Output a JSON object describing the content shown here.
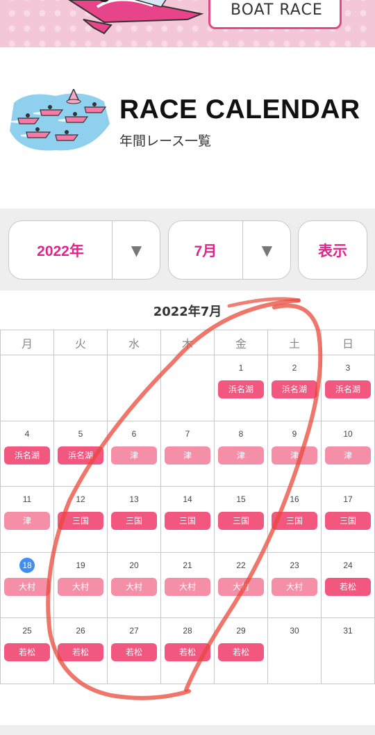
{
  "banner": {
    "brand_text": "BOAT RACE"
  },
  "hero": {
    "title": "RACE CALENDAR",
    "subtitle": "年間レース一覧"
  },
  "controls": {
    "year_value": "2022年",
    "month_value": "7月",
    "dropdown_arrow": "▼",
    "show_label": "表示"
  },
  "calendar": {
    "title": "2022年7月",
    "weekdays": [
      "月",
      "火",
      "水",
      "木",
      "金",
      "土",
      "日"
    ],
    "today": 18,
    "weeks": [
      [
        {
          "day": ""
        },
        {
          "day": ""
        },
        {
          "day": ""
        },
        {
          "day": ""
        },
        {
          "day": "1",
          "venue": "浜名湖",
          "shade": "dark"
        },
        {
          "day": "2",
          "venue": "浜名湖",
          "shade": "dark"
        },
        {
          "day": "3",
          "venue": "浜名湖",
          "shade": "dark"
        }
      ],
      [
        {
          "day": "4",
          "venue": "浜名湖",
          "shade": "dark"
        },
        {
          "day": "5",
          "venue": "浜名湖",
          "shade": "dark"
        },
        {
          "day": "6",
          "venue": "津",
          "shade": "light"
        },
        {
          "day": "7",
          "venue": "津",
          "shade": "light"
        },
        {
          "day": "8",
          "venue": "津",
          "shade": "light"
        },
        {
          "day": "9",
          "venue": "津",
          "shade": "light"
        },
        {
          "day": "10",
          "venue": "津",
          "shade": "light"
        }
      ],
      [
        {
          "day": "11",
          "venue": "津",
          "shade": "light"
        },
        {
          "day": "12",
          "venue": "三国",
          "shade": "dark"
        },
        {
          "day": "13",
          "venue": "三国",
          "shade": "dark"
        },
        {
          "day": "14",
          "venue": "三国",
          "shade": "dark"
        },
        {
          "day": "15",
          "venue": "三国",
          "shade": "dark"
        },
        {
          "day": "16",
          "venue": "三国",
          "shade": "dark"
        },
        {
          "day": "17",
          "venue": "三国",
          "shade": "dark"
        }
      ],
      [
        {
          "day": "18",
          "venue": "大村",
          "shade": "light"
        },
        {
          "day": "19",
          "venue": "大村",
          "shade": "light"
        },
        {
          "day": "20",
          "venue": "大村",
          "shade": "light"
        },
        {
          "day": "21",
          "venue": "大村",
          "shade": "light"
        },
        {
          "day": "22",
          "venue": "大村",
          "shade": "light"
        },
        {
          "day": "23",
          "venue": "大村",
          "shade": "light"
        },
        {
          "day": "24",
          "venue": "若松",
          "shade": "dark"
        }
      ],
      [
        {
          "day": "25",
          "venue": "若松",
          "shade": "dark"
        },
        {
          "day": "26",
          "venue": "若松",
          "shade": "dark"
        },
        {
          "day": "27",
          "venue": "若松",
          "shade": "dark"
        },
        {
          "day": "28",
          "venue": "若松",
          "shade": "dark"
        },
        {
          "day": "29",
          "venue": "若松",
          "shade": "dark"
        },
        {
          "day": "30"
        },
        {
          "day": "31"
        }
      ]
    ]
  },
  "colors": {
    "accent": "#e0248a",
    "tag_dark": "#f2577f",
    "tag_light": "#f58fa8",
    "today_badge": "#3f8ef0",
    "banner_pink": "#f3c6d8",
    "annotation": "#e8483a"
  },
  "icons": [
    "boat-mascot-icon",
    "race-boats-illustration-icon",
    "dropdown-arrow-icon"
  ]
}
